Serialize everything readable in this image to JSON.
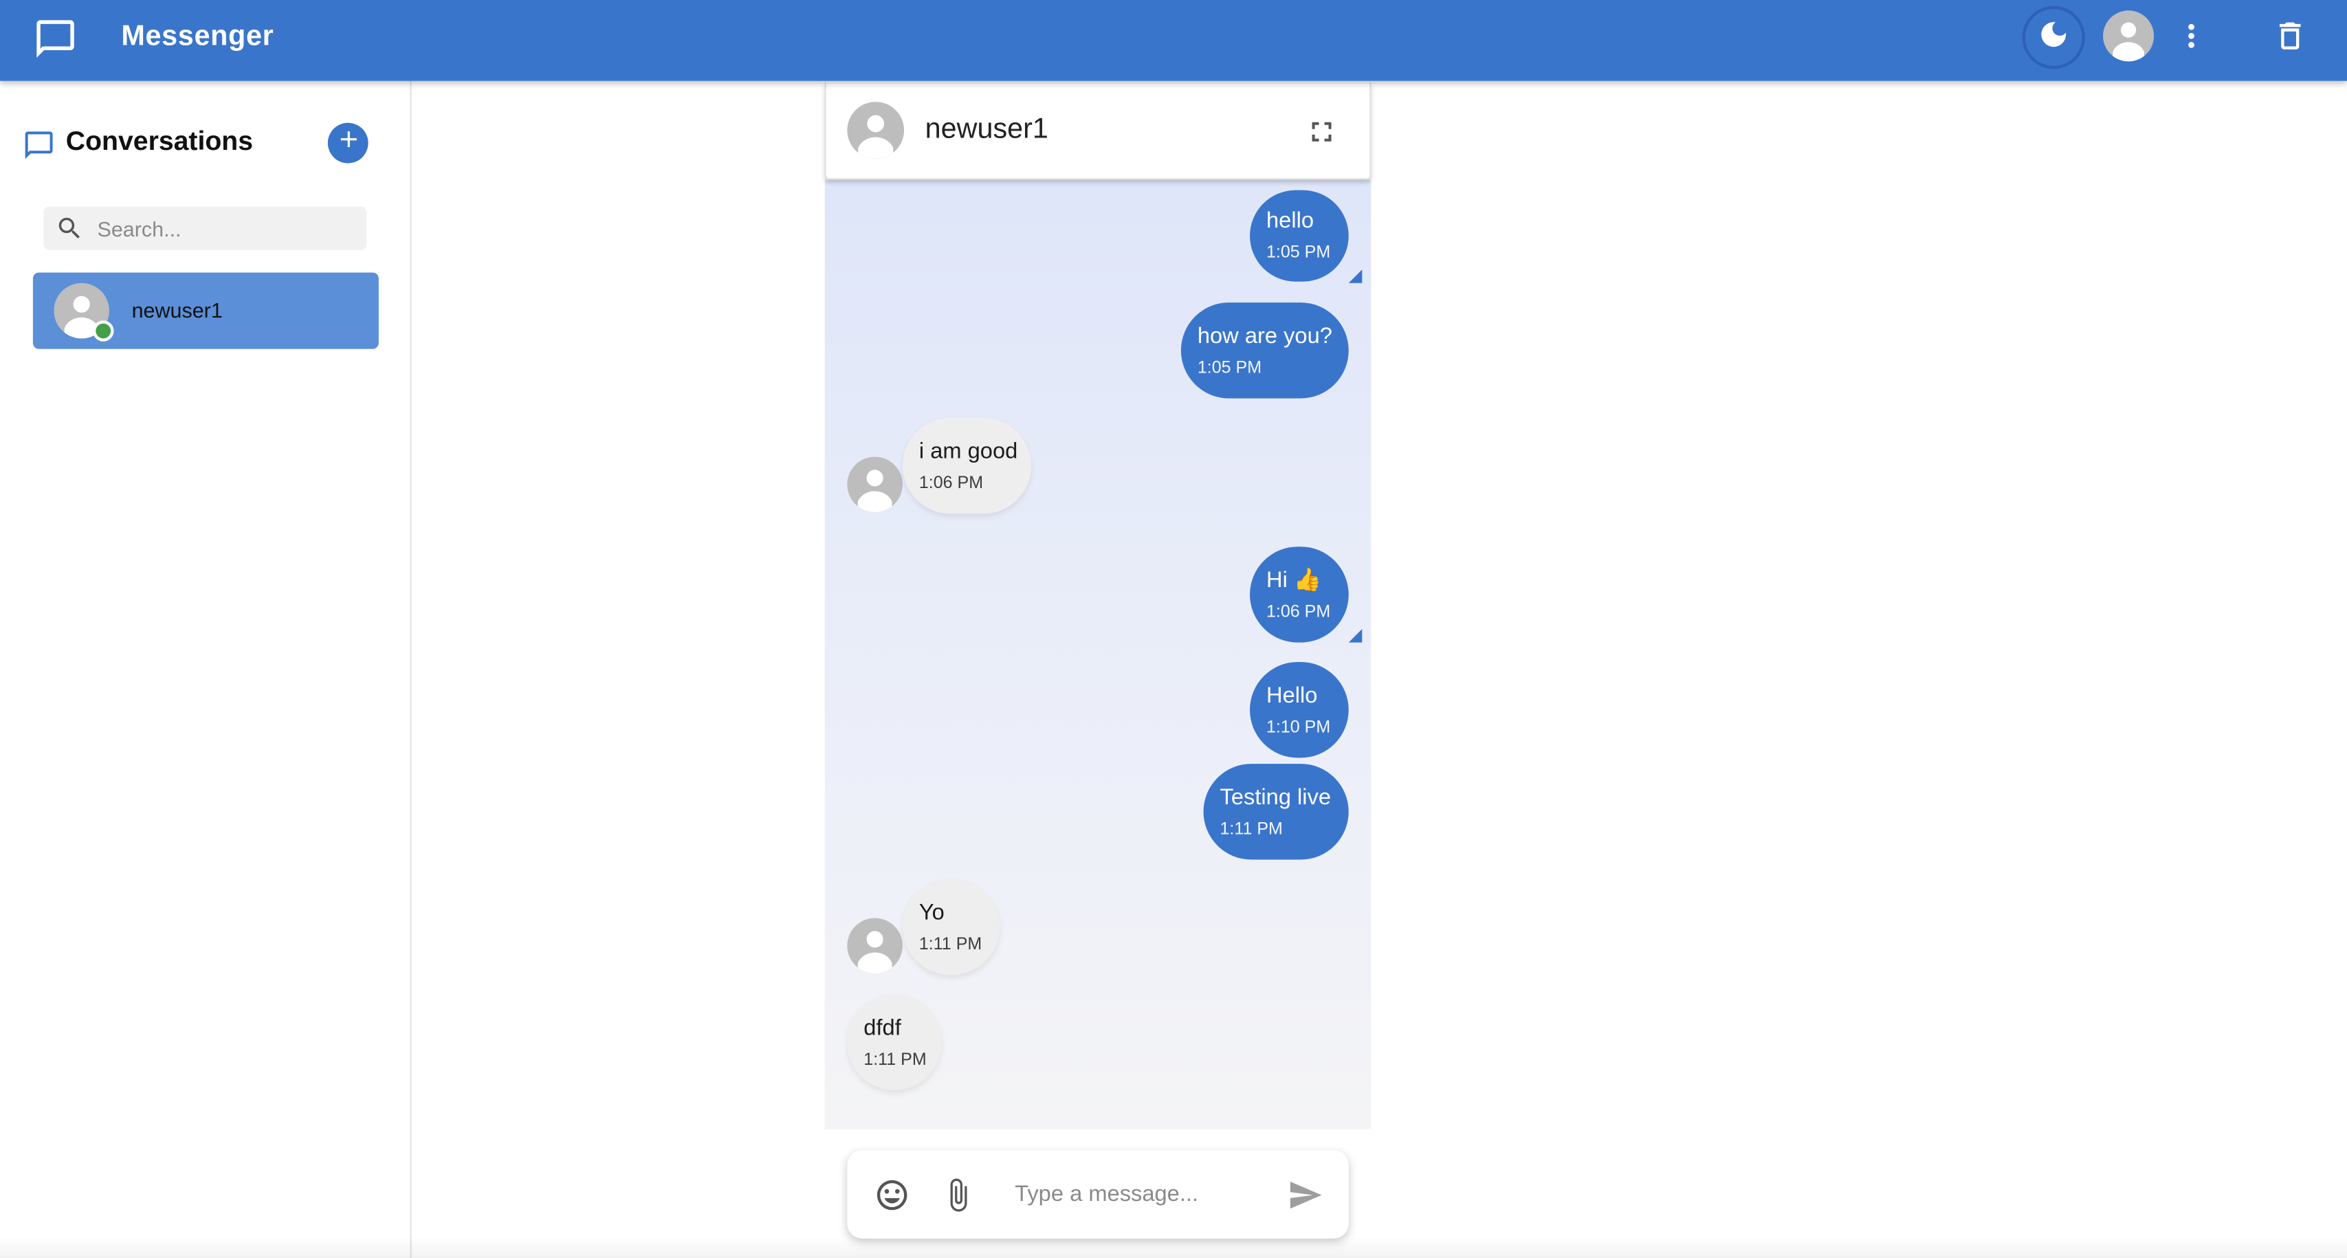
{
  "app": {
    "title": "Messenger",
    "accent_color": "#3a75cc",
    "icons": [
      "chat-bubble-icon",
      "moon-icon",
      "account-icon",
      "more-vert-icon",
      "delete-icon"
    ]
  },
  "sidebar": {
    "title": "Conversations",
    "add_button_icon": "plus-icon",
    "search": {
      "placeholder": "Search...",
      "value": ""
    },
    "conversations": [
      {
        "name": "newuser1",
        "status": "online",
        "selected": true
      }
    ]
  },
  "chat": {
    "contact_name": "newuser1",
    "fullscreen_icon": "fullscreen-icon",
    "messages": [
      {
        "direction": "out",
        "text": "hello",
        "time": "1:05 PM"
      },
      {
        "direction": "out",
        "text": "how are you?",
        "time": "1:05 PM"
      },
      {
        "direction": "in",
        "text": "i am good",
        "time": "1:06 PM"
      },
      {
        "direction": "out",
        "text": "Hi 👍",
        "time": "1:06 PM"
      },
      {
        "direction": "out",
        "text": "Hello",
        "time": "1:10 PM"
      },
      {
        "direction": "out",
        "text": "Testing live",
        "time": "1:11 PM"
      },
      {
        "direction": "in",
        "text": "Yo",
        "time": "1:11 PM"
      },
      {
        "direction": "in",
        "text": "dfdf",
        "time": "1:11 PM"
      }
    ]
  },
  "composer": {
    "placeholder": "Type a message...",
    "value": ""
  }
}
